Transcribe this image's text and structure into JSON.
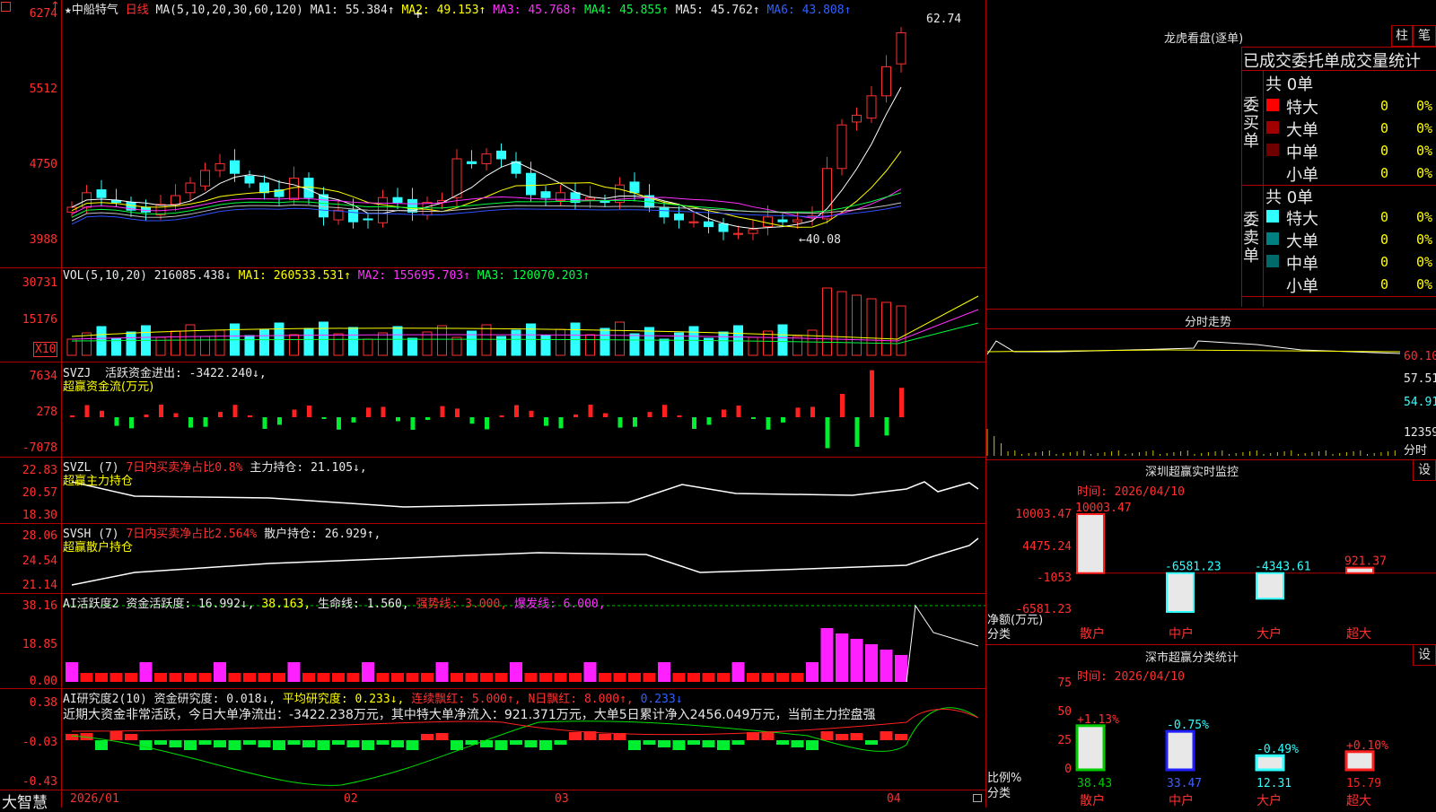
{
  "app_name": "大智慧",
  "stock": {
    "title": "★中船特气",
    "period": "日线"
  },
  "ma_line": {
    "label": "MA(5,10,20,30,60,120)",
    "ma1": "MA1: 55.384↑",
    "ma2": "MA2: 49.153↑",
    "ma3": "MA3: 45.768↑",
    "ma4": "MA4: 45.855↑",
    "ma5": "MA5: 45.762↑",
    "ma6": "MA6: 43.808↑"
  },
  "price_axis": [
    "6274",
    "5512",
    "4750",
    "3988"
  ],
  "price_high_label": "62.74",
  "price_low_label": "40.08",
  "vol": {
    "label": "VOL(5,10,20)",
    "value": "216085.438↓",
    "ma1": "MA1: 260533.531↑",
    "ma2": "MA2: 155695.703↑",
    "ma3": "MA3: 120070.203↑",
    "axis": [
      "30731",
      "15176"
    ],
    "unit": "X10"
  },
  "svzj": {
    "label": "SVZJ",
    "desc": "活跃资金进出: -3422.240↓,",
    "sub": "超赢资金流(万元)",
    "axis": [
      "7634",
      "278",
      "-7078"
    ]
  },
  "svzl": {
    "label": "SVZL (7)",
    "desc": "7日内买卖净占比0.8%",
    "holding": "主力持仓: 21.105↓,",
    "sub": "超赢主力持仓",
    "axis": [
      "22.83",
      "20.57",
      "18.30"
    ]
  },
  "svsh": {
    "label": "SVSH (7)",
    "desc": "7日内买卖净占比2.564%",
    "holding": "散户持仓: 26.929↑,",
    "sub": "超赢散户持仓",
    "axis": [
      "28.06",
      "24.54",
      "21.14"
    ]
  },
  "active": {
    "label": "AI活跃度2",
    "v1": "资金活跃度: 16.992↓,",
    "v2": "38.163,",
    "v3": "生命线: 1.560,",
    "v4": "强势线: 3.000,",
    "v5": "爆发线: 6.000,",
    "axis": [
      "38.16",
      "18.85",
      "0.00"
    ]
  },
  "research": {
    "label": "AI研究度2(10)",
    "v1": "资金研究度: 0.018↓,",
    "v2": "平均研究度: 0.233↓,",
    "v3": "连续飘红: 5.000↑,",
    "v4": "N日飘红: 8.000↑,",
    "v5": "0.233↓",
    "comment": "近期大资金非常活跃，今日大单净流出：-3422.238万元，其中特大单净流入：921.371万元，大单5日累计净入2456.049万元，当前主力控盘强",
    "axis": [
      "0.38",
      "-0.03",
      "-0.43"
    ]
  },
  "date_axis": [
    "2026/01",
    "02",
    "03",
    "04"
  ],
  "right": {
    "dragon_title": "龙虎看盘(逐单)",
    "btn_bar": "柱",
    "btn_pen": "笔",
    "header": "已成交委托单成交量统计",
    "buy_label": "委买单",
    "sell_label": "委卖单",
    "buy_total": "共 0单",
    "sell_total": "共 0单",
    "buy_rows": [
      {
        "name": "特大",
        "count": "0",
        "pct": "0%",
        "color": "#ff0000"
      },
      {
        "name": "大单",
        "count": "0",
        "pct": "0%",
        "color": "#a00000"
      },
      {
        "name": "中单",
        "count": "0",
        "pct": "0%",
        "color": "#700000"
      },
      {
        "name": "小单",
        "count": "0",
        "pct": "0%",
        "color": ""
      }
    ],
    "sell_rows": [
      {
        "name": "特大",
        "count": "0",
        "pct": "0%",
        "color": "#30ffff"
      },
      {
        "name": "大单",
        "count": "0",
        "pct": "0%",
        "color": "#008080"
      },
      {
        "name": "中单",
        "count": "0",
        "pct": "0%",
        "color": "#006a6a"
      },
      {
        "name": "小单",
        "count": "0",
        "pct": "0%",
        "color": ""
      }
    ],
    "intraday_title": "分时走势",
    "intraday_axis": [
      "60.10",
      "57.51",
      "54.91",
      "12359",
      "分时"
    ],
    "monitor": {
      "title": "深圳超赢实时监控",
      "settings": "设",
      "time": "时间: 2026/04/10",
      "axis": [
        "10003.47",
        "4475.24",
        "-1053",
        "-6581.23"
      ],
      "ylabel": "净额(万元)",
      "xlabel": "分类",
      "categories": [
        "散户",
        "中户",
        "大户",
        "超大"
      ],
      "values": [
        "10003.47",
        "-6581.23",
        "-4343.61",
        "921.37"
      ]
    },
    "classify": {
      "title": "深市超赢分类统计",
      "settings": "设",
      "time": "时间: 2026/04/10",
      "axis": [
        "75",
        "50",
        "25",
        "0"
      ],
      "ylabel": "比例%",
      "xlabel": "分类",
      "categories": [
        "散户",
        "中户",
        "大户",
        "超大"
      ],
      "changes": [
        "+1.13%",
        "-0.75%",
        "-0.49%",
        "+0.10%"
      ],
      "values": [
        "38.43",
        "33.47",
        "12.31",
        "15.79"
      ]
    }
  },
  "chart_data": {
    "type": "bar",
    "title": "深圳超赢实时监控",
    "ylabel": "净额(万元)",
    "categories": [
      "散户",
      "中户",
      "大户",
      "超大"
    ],
    "values": [
      10003.47,
      -6581.23,
      -4343.61,
      921.37
    ],
    "classify_values": [
      38.43,
      33.47,
      12.31,
      15.79
    ],
    "close_prices": [
      43.5,
      45.0,
      44.5,
      44.0,
      43.2,
      43.0,
      43.8,
      44.7,
      46.0,
      47.3,
      48.0,
      47.0,
      46.0,
      45.0,
      44.6,
      46.5,
      44.5,
      42.5,
      43.2,
      42.0,
      42.2,
      44.5,
      44.0,
      43.0,
      44.0,
      44.2,
      48.5,
      48.0,
      49.0,
      48.5,
      47.0,
      44.8,
      44.5,
      45.0,
      44.0,
      44.5,
      44.0,
      45.8,
      45.0,
      43.5,
      42.5,
      42.2,
      42.0,
      41.5,
      41.0,
      40.8,
      41.2,
      42.5,
      42.0,
      42.2,
      42.6,
      47.5,
      52.0,
      53.0,
      55.0,
      58.0,
      61.5
    ]
  }
}
